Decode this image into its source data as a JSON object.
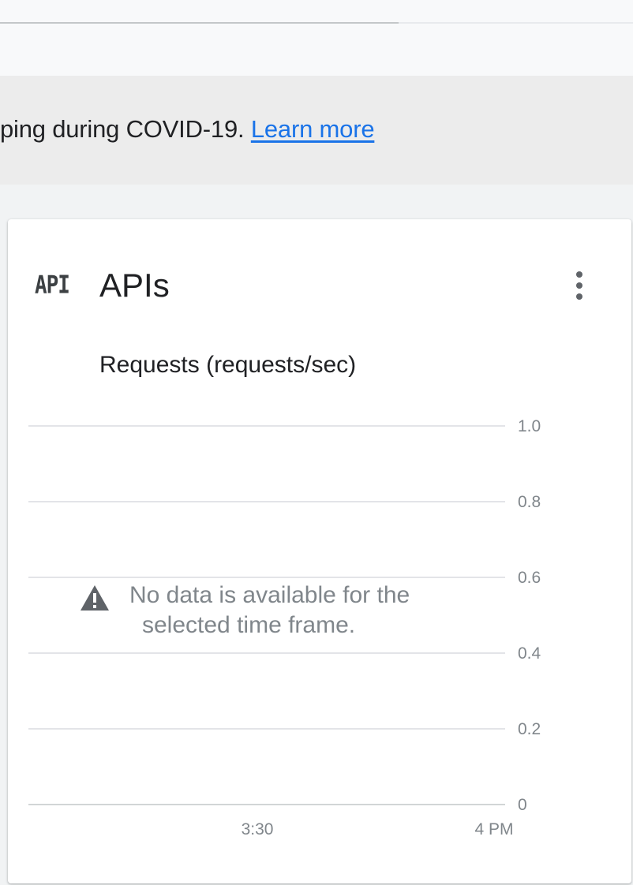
{
  "banner": {
    "text": "ping during COVID-19.",
    "link_label": "Learn more"
  },
  "top_progress": {
    "fraction": 0.63
  },
  "card": {
    "icon": "api-icon",
    "icon_text": "API",
    "title": "APIs",
    "menu_icon": "more-vert-icon"
  },
  "chart": {
    "no_data_line1": "No data is available for the",
    "no_data_line2": "selected time frame.",
    "warning_icon": "warning-icon"
  },
  "chart_data": {
    "type": "line",
    "title": "Requests (requests/sec)",
    "xlabel": "",
    "ylabel": "",
    "ylim": [
      0,
      1.0
    ],
    "y_ticks": [
      "1.0",
      "0.8",
      "0.6",
      "0.4",
      "0.2",
      "0"
    ],
    "y_tick_values": [
      1.0,
      0.8,
      0.6,
      0.4,
      0.2,
      0
    ],
    "x_ticks": [
      "3:30",
      "4 PM"
    ],
    "series": [],
    "grid": true,
    "y_axis_side": "right"
  },
  "colors": {
    "link": "#1a73e8",
    "banner_bg": "#ececec",
    "grid": "#dadce0",
    "axis_text": "#80868b"
  }
}
